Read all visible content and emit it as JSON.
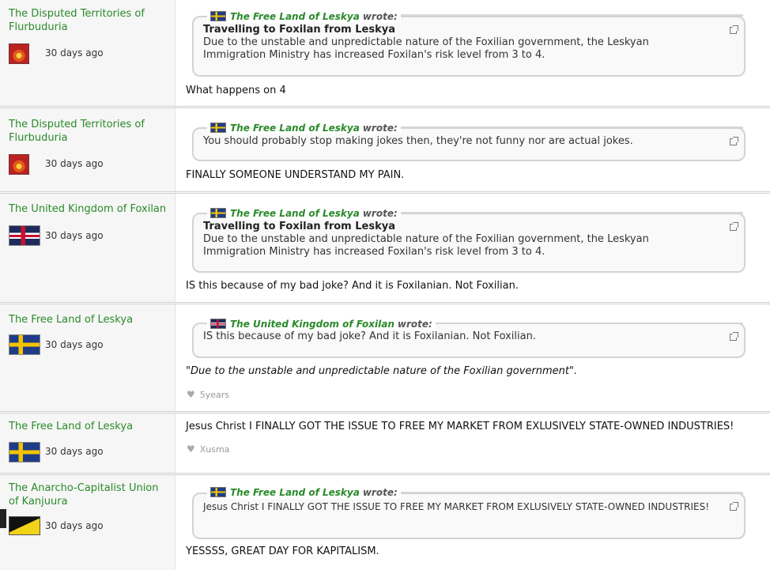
{
  "posts": [
    {
      "nation": "The Disputed Territories of Flurbuduria",
      "flag_icon": "flurbuduria-flag-icon",
      "time": "30 days ago",
      "quote": {
        "author": "The Free Land of Leskya",
        "wrote": "wrote:",
        "title": "Travelling to Foxilan from Leskya",
        "text": "Due to the unstable and unpredictable nature of the Foxilian government, the Leskyan Immigration Ministry has increased Foxilan's risk level from 3 to 4."
      },
      "body": "What happens on 4"
    },
    {
      "nation": "The Disputed Territories of Flurbuduria",
      "flag_icon": "flurbuduria-flag-icon",
      "time": "30 days ago",
      "quote": {
        "author": "The Free Land of Leskya",
        "wrote": "wrote:",
        "title": "",
        "text": "You should probably stop making jokes then, they're not funny nor are actual jokes."
      },
      "body": "FINALLY SOMEONE UNDERSTAND MY PAIN."
    },
    {
      "nation": "The United Kingdom of Foxilan",
      "flag_icon": "foxilan-flag-icon",
      "time": "30 days ago",
      "quote": {
        "author": "The Free Land of Leskya",
        "wrote": "wrote:",
        "title": "Travelling to Foxilan from Leskya",
        "text": "Due to the unstable and unpredictable nature of the Foxilian government, the Leskyan Immigration Ministry has increased Foxilan's risk level from 3 to 4."
      },
      "body": "IS this because of my bad joke? And it is Foxilanian. Not Foxilian."
    },
    {
      "nation": "The Free Land of Leskya",
      "flag_icon": "leskya-flag-icon",
      "time": "30 days ago",
      "quote": {
        "author": "The United Kingdom of Foxilan",
        "wrote": "wrote:",
        "title": "",
        "text": "IS this because of my bad joke? And it is Foxilanian. Not Foxilian."
      },
      "body": "\"Due to the unstable and unpredictable nature of the Foxilian government\".",
      "likes": "5years"
    },
    {
      "nation": "The Free Land of Leskya",
      "flag_icon": "leskya-flag-icon",
      "time": "30 days ago",
      "body": "Jesus Christ I FINALLY GOT THE ISSUE TO FREE MY MARKET FROM EXLUSIVELY STATE-OWNED INDUSTRIES!",
      "likes": "Xusma"
    },
    {
      "nation": "The Anarcho-Capitalist Union of Kanjuura",
      "flag_icon": "kanjuura-flag-icon",
      "time": "30 days ago",
      "quote": {
        "author": "The Free Land of Leskya",
        "wrote": "wrote:",
        "title": "",
        "text": "Jesus Christ I FINALLY GOT THE ISSUE TO FREE MY MARKET FROM EXLUSIVELY STATE-OWNED INDUSTRIES!"
      },
      "body": "YESSSS, GREAT DAY FOR KAPITALISM."
    }
  ]
}
